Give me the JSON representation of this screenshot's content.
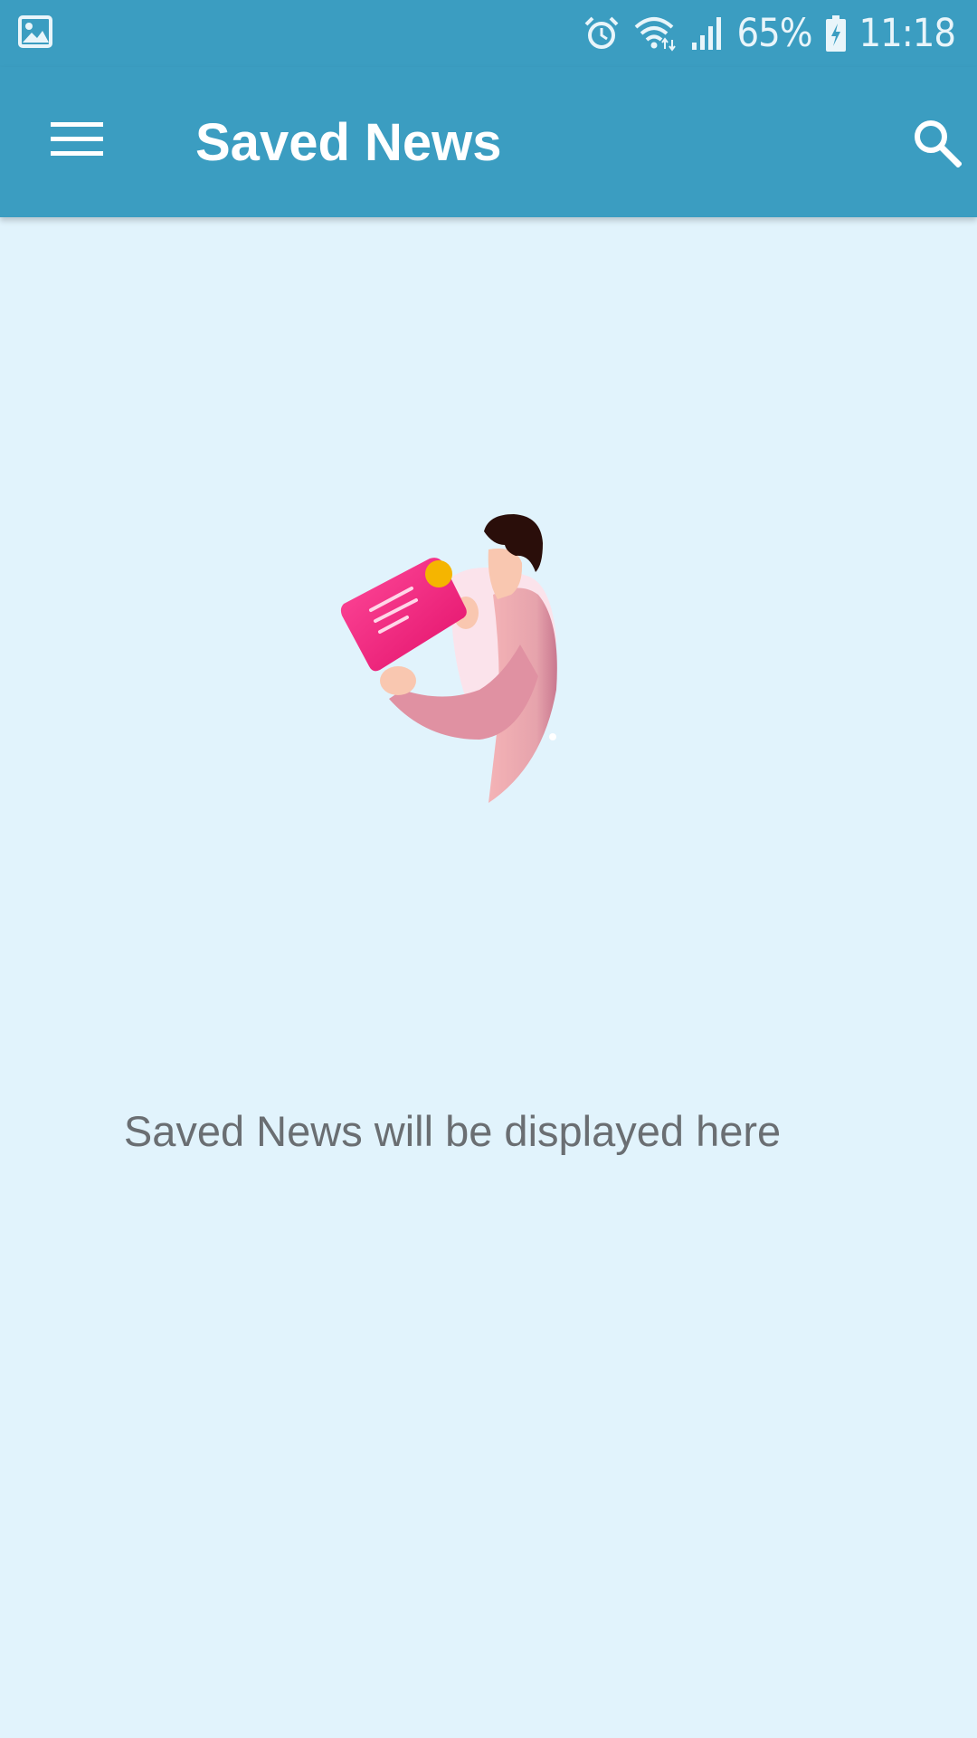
{
  "status_bar": {
    "battery_percent": "65%",
    "time": "11:18",
    "icons": [
      "gallery-icon",
      "alarm-icon",
      "wifi-icon",
      "signal-icon",
      "battery-charging-icon"
    ]
  },
  "app_bar": {
    "title": "Saved News",
    "menu_icon": "hamburger-menu-icon",
    "search_icon": "search-icon"
  },
  "empty_state": {
    "illustration": "person-reading-document-illustration",
    "message": "Saved News will be displayed here"
  },
  "colors": {
    "app_bar": "#3B9DC1",
    "background": "#E1F3FC",
    "message_text": "#6A6E72",
    "accent_pink": "#F0287A",
    "accent_yellow": "#F5B500"
  }
}
